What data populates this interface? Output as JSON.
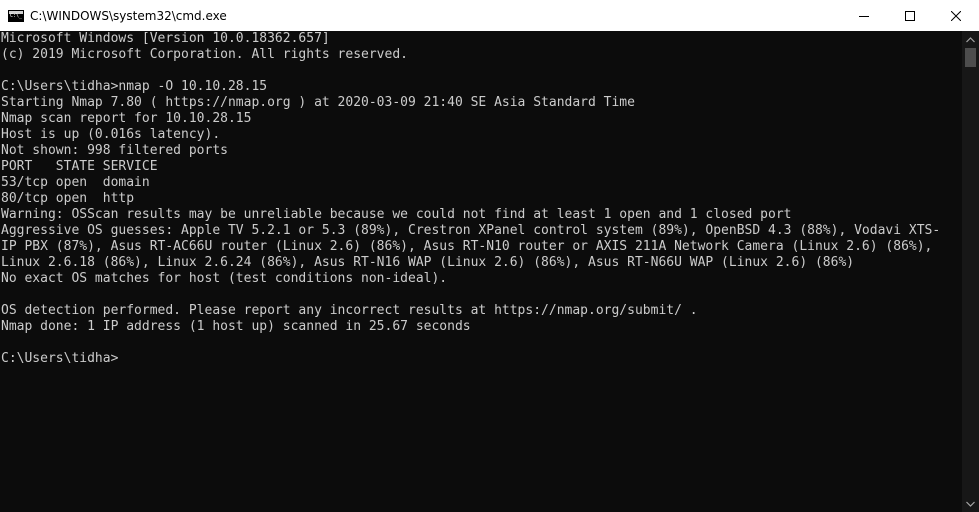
{
  "window": {
    "title": "C:\\WINDOWS\\system32\\cmd.exe"
  },
  "icons": {
    "app": "cmd-icon",
    "minimize": "minimize-icon",
    "maximize": "maximize-icon",
    "close": "close-icon",
    "scroll_up": "chevron-up-icon",
    "scroll_down": "chevron-down-icon"
  },
  "colors": {
    "console_bg": "#0c0c0c",
    "console_text": "#cccccc",
    "titlebar_bg": "#ffffff"
  },
  "console": {
    "lines": [
      "Microsoft Windows [Version 10.0.18362.657]",
      "(c) 2019 Microsoft Corporation. All rights reserved.",
      "",
      "C:\\Users\\tidha>nmap -O 10.10.28.15",
      "Starting Nmap 7.80 ( https://nmap.org ) at 2020-03-09 21:40 SE Asia Standard Time",
      "Nmap scan report for 10.10.28.15",
      "Host is up (0.016s latency).",
      "Not shown: 998 filtered ports",
      "PORT   STATE SERVICE",
      "53/tcp open  domain",
      "80/tcp open  http",
      "Warning: OSScan results may be unreliable because we could not find at least 1 open and 1 closed port",
      "Aggressive OS guesses: Apple TV 5.2.1 or 5.3 (89%), Crestron XPanel control system (89%), OpenBSD 4.3 (88%), Vodavi XTS-",
      "IP PBX (87%), Asus RT-AC66U router (Linux 2.6) (86%), Asus RT-N10 router or AXIS 211A Network Camera (Linux 2.6) (86%),",
      "Linux 2.6.18 (86%), Linux 2.6.24 (86%), Asus RT-N16 WAP (Linux 2.6) (86%), Asus RT-N66U WAP (Linux 2.6) (86%)",
      "No exact OS matches for host (test conditions non-ideal).",
      "",
      "OS detection performed. Please report any incorrect results at https://nmap.org/submit/ .",
      "Nmap done: 1 IP address (1 host up) scanned in 25.67 seconds",
      "",
      "C:\\Users\\tidha>"
    ]
  }
}
